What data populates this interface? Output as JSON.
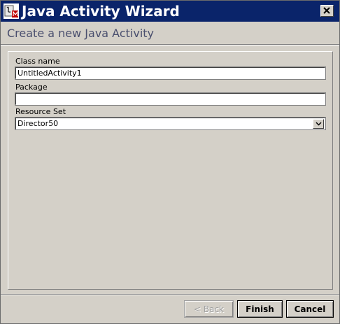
{
  "window": {
    "title": "Java Activity Wizard",
    "icon": "java-app-icon",
    "close_icon": "close-icon"
  },
  "heading": "Create a new Java Activity",
  "form": {
    "class_name_label": "Class name",
    "class_name_value": "UntitledActivity1",
    "package_label": "Package",
    "package_value": "",
    "resource_set_label": "Resource Set",
    "resource_set_value": "Director50",
    "dropdown_icon": "chevron-down-icon"
  },
  "buttons": {
    "back": "< Back",
    "finish": "Finish",
    "cancel": "Cancel"
  },
  "colors": {
    "titlebar": "#0a246a",
    "dialog_bg": "#d4d0c8",
    "heading_text": "#4a4f6e"
  }
}
